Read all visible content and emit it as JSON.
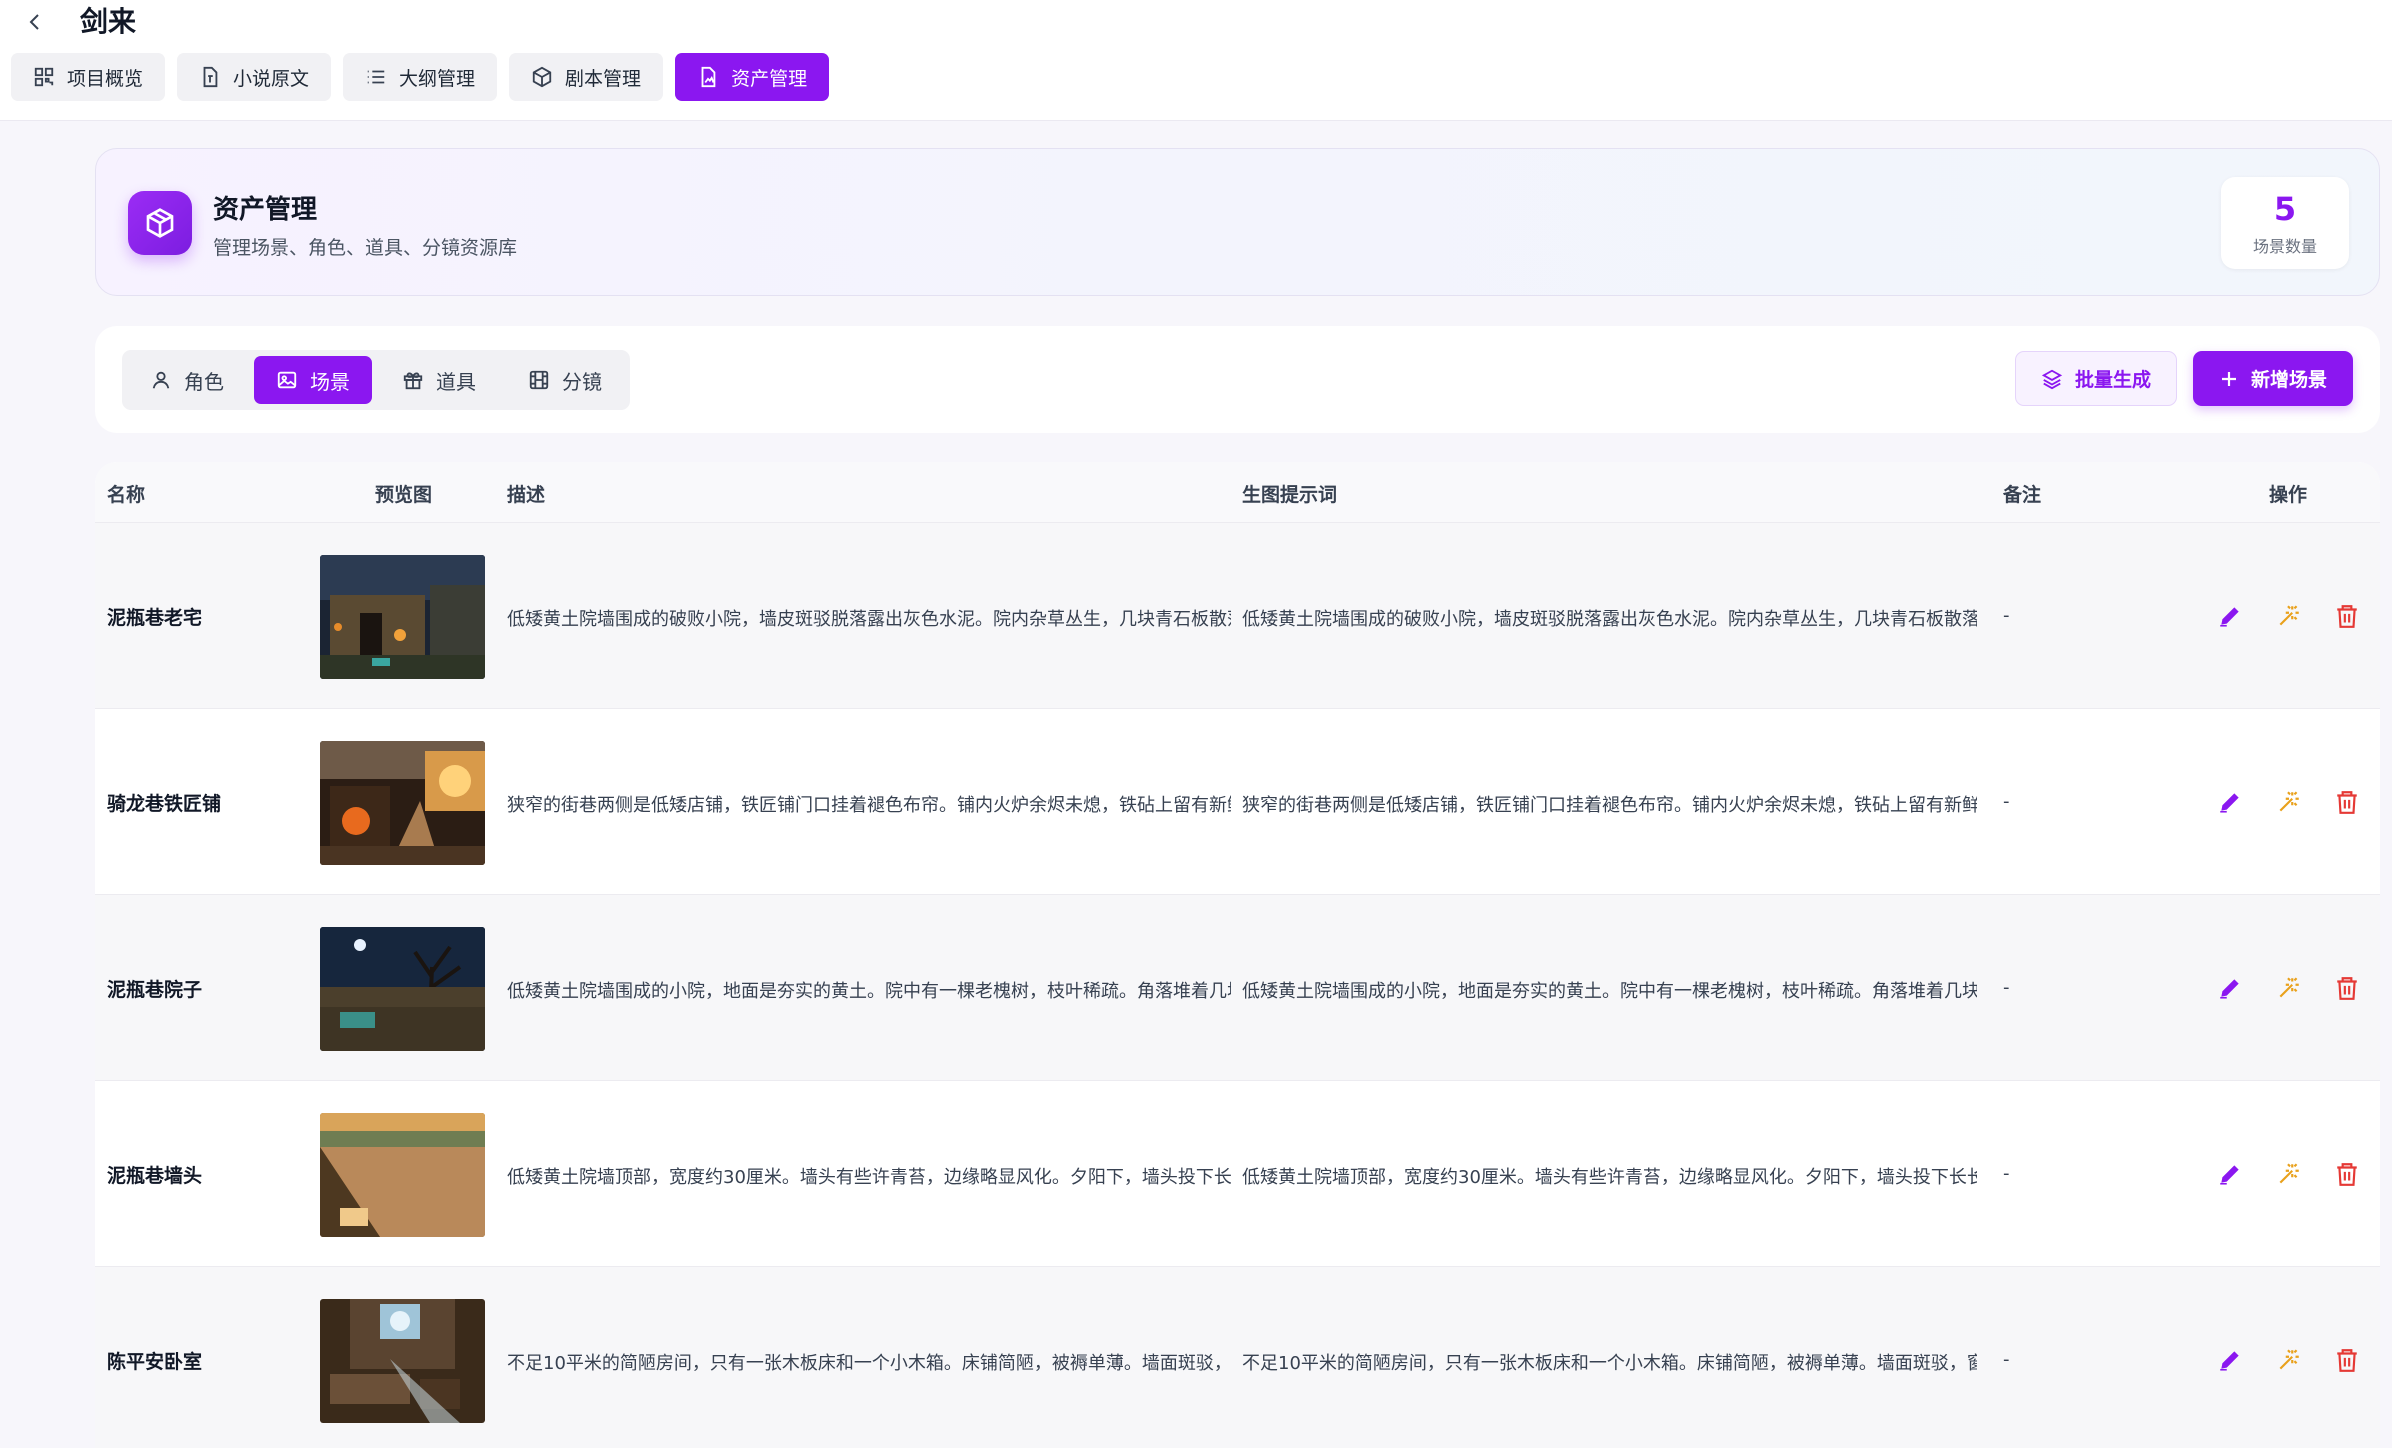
{
  "header": {
    "title": "剑来",
    "tabs": [
      {
        "label": "项目概览",
        "icon": "grid-icon",
        "active": false
      },
      {
        "label": "小说原文",
        "icon": "file-text-icon",
        "active": false
      },
      {
        "label": "大纲管理",
        "icon": "list-icon",
        "active": false
      },
      {
        "label": "剧本管理",
        "icon": "cube-icon",
        "active": false
      },
      {
        "label": "资产管理",
        "icon": "image-file-icon",
        "active": true
      }
    ]
  },
  "hero": {
    "title": "资产管理",
    "subtitle": "管理场景、角色、道具、分镜资源库",
    "stat_value": "5",
    "stat_label": "场景数量"
  },
  "toolbar": {
    "tabs": [
      {
        "label": "角色",
        "icon": "user-icon",
        "active": false
      },
      {
        "label": "场景",
        "icon": "image-icon",
        "active": true
      },
      {
        "label": "道具",
        "icon": "gift-icon",
        "active": false
      },
      {
        "label": "分镜",
        "icon": "film-icon",
        "active": false
      }
    ],
    "batch_label": "批量生成",
    "add_label": "新增场景"
  },
  "table": {
    "columns": {
      "name": "名称",
      "preview": "预览图",
      "desc": "描述",
      "prompt": "生图提示词",
      "note": "备注",
      "actions": "操作"
    },
    "rows": [
      {
        "name": "泥瓶巷老宅",
        "desc": "低矮黄土院墙围成的破败小院，墙皮斑驳脱落露出灰色水泥。院内杂草丛生，几块青石板散落",
        "prompt": "低矮黄土院墙围成的破败小院，墙皮斑驳脱落露出灰色水泥。院内杂草丛生，几块青石板散落在地",
        "note": "-"
      },
      {
        "name": "骑龙巷铁匠铺",
        "desc": "狭窄的街巷两侧是低矮店铺，铁匠铺门口挂着褪色布帘。铺内火炉余烬未熄，铁砧上留有新鲜",
        "prompt": "狭窄的街巷两侧是低矮店铺，铁匠铺门口挂着褪色布帘。铺内火炉余烬未熄，铁砧上留有新鲜锤印",
        "note": "-"
      },
      {
        "name": "泥瓶巷院子",
        "desc": "低矮黄土院墙围成的小院，地面是夯实的黄土。院中有一棵老槐树，枝叶稀疏。角落堆着几块",
        "prompt": "低矮黄土院墙围成的小院，地面是夯实的黄土。院中有一棵老槐树，枝叶稀疏。角落堆着几块青石",
        "note": "-"
      },
      {
        "name": "泥瓶巷墙头",
        "desc": "低矮黄土院墙顶部，宽度约30厘米。墙头有些许青苔，边缘略显风化。夕阳下，墙头投下长长",
        "prompt": "低矮黄土院墙顶部，宽度约30厘米。墙头有些许青苔，边缘略显风化。夕阳下，墙头投下长长阴影",
        "note": "-"
      },
      {
        "name": "陈平安卧室",
        "desc": "不足10平米的简陋房间，只有一张木板床和一个小木箱。床铺简陋，被褥单薄。墙面斑驳，窗",
        "prompt": "不足10平米的简陋房间，只有一张木板床和一个小木箱。床铺简陋，被褥单薄。墙面斑驳，窗纸破",
        "note": "-"
      }
    ]
  },
  "colors": {
    "accent": "#8b17f0",
    "edit": "#8b17f0",
    "generate": "#e9a11c",
    "delete": "#e53935"
  }
}
